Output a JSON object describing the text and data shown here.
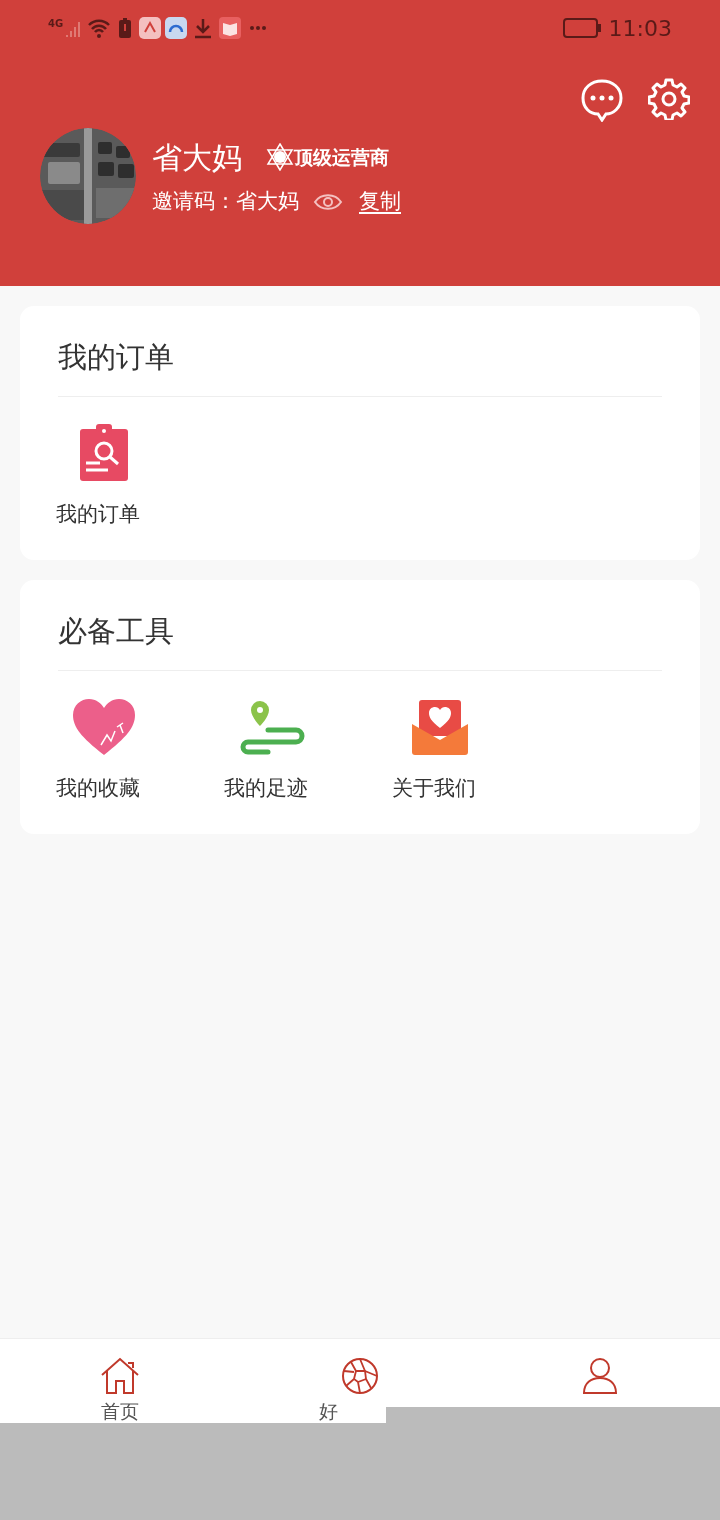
{
  "status_bar": {
    "network": "4G",
    "time": "11:03"
  },
  "profile": {
    "name": "省大妈",
    "badge": "顶级运营商",
    "invite_label": "邀请码：",
    "invite_code": "省大妈",
    "copy": "复制"
  },
  "sections": [
    {
      "title": "我的订单",
      "items": [
        {
          "label": "我的订单",
          "kind": "order"
        }
      ]
    },
    {
      "title": "必备工具",
      "items": [
        {
          "label": "我的收藏",
          "kind": "favorite"
        },
        {
          "label": "我的足迹",
          "kind": "footprint"
        },
        {
          "label": "关于我们",
          "kind": "about"
        }
      ]
    }
  ],
  "tab_bar": [
    {
      "label": "首页",
      "kind": "home"
    },
    {
      "label": "好",
      "kind": "goods"
    },
    {
      "kind": "profile"
    }
  ]
}
